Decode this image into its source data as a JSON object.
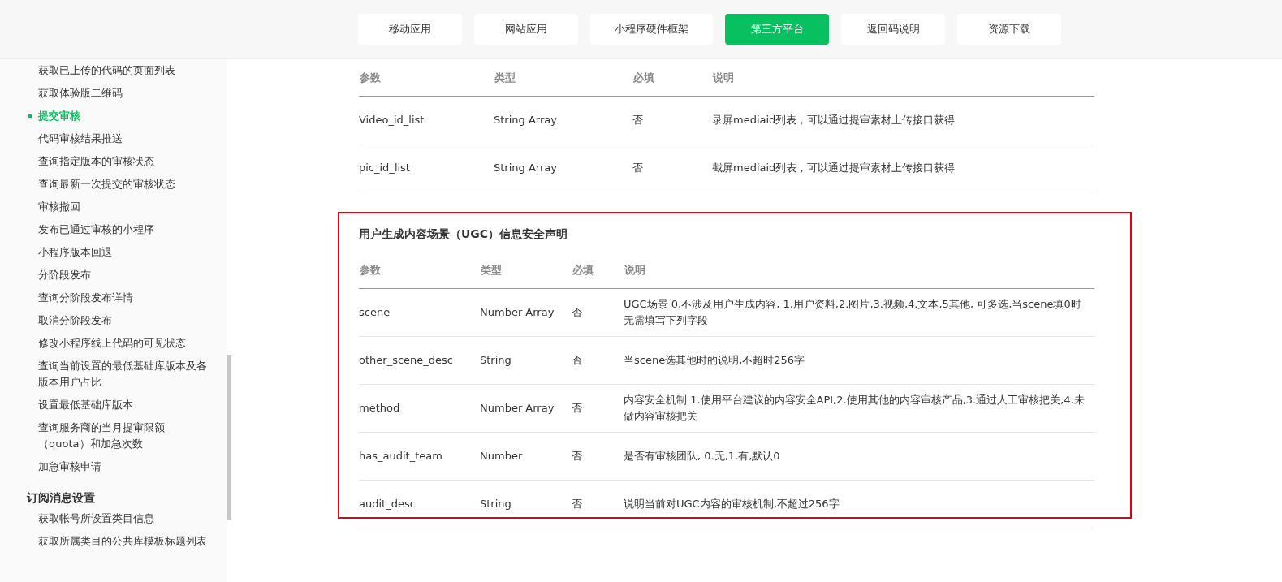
{
  "nav_tabs": [
    {
      "label": "移动应用",
      "selected": false
    },
    {
      "label": "网站应用",
      "selected": false
    },
    {
      "label": "小程序硬件框架",
      "selected": false
    },
    {
      "label": "第三方平台",
      "selected": true
    },
    {
      "label": "返回码说明",
      "selected": false
    },
    {
      "label": "资源下载",
      "selected": false
    }
  ],
  "sidebar": {
    "groups": [
      {
        "items": [
          {
            "label": "获取已上传的代码的页面列表",
            "selected": false
          },
          {
            "label": "获取体验版二维码",
            "selected": false
          },
          {
            "label": "提交审核",
            "selected": true
          },
          {
            "label": "代码审核结果推送",
            "selected": false
          },
          {
            "label": "查询指定版本的审核状态",
            "selected": false
          },
          {
            "label": "查询最新一次提交的审核状态",
            "selected": false
          },
          {
            "label": "审核撤回",
            "selected": false
          },
          {
            "label": "发布已通过审核的小程序",
            "selected": false
          },
          {
            "label": "小程序版本回退",
            "selected": false
          },
          {
            "label": "分阶段发布",
            "selected": false
          },
          {
            "label": "查询分阶段发布详情",
            "selected": false
          },
          {
            "label": "取消分阶段发布",
            "selected": false
          },
          {
            "label": "修改小程序线上代码的可见状态",
            "selected": false
          },
          {
            "label": "查询当前设置的最低基础库版本及各版本用户占比",
            "selected": false
          },
          {
            "label": "设置最低基础库版本",
            "selected": false
          },
          {
            "label": "查询服务商的当月提审限额（quota）和加急次数",
            "selected": false
          },
          {
            "label": "加急审核申请",
            "selected": false
          }
        ]
      },
      {
        "title": "订阅消息设置",
        "items": [
          {
            "label": "获取帐号所设置类目信息",
            "selected": false
          },
          {
            "label": "获取所属类目的公共库模板标题列表",
            "selected": false
          }
        ]
      }
    ]
  },
  "params_table": {
    "columns": [
      "参数",
      "类型",
      "必填",
      "说明"
    ],
    "rows": [
      [
        "Video_id_list",
        "String Array",
        "否",
        "录屏mediaid列表，可以通过提审素材上传接口获得"
      ],
      [
        "pic_id_list",
        "String Array",
        "否",
        "截屏mediaid列表，可以通过提审素材上传接口获得"
      ]
    ]
  },
  "ugc_section": {
    "title": "用户生成内容场景（UGC）信息安全声明",
    "highlighted": true,
    "columns": [
      "参数",
      "类型",
      "必填",
      "说明"
    ],
    "rows": [
      [
        "scene",
        "Number Array",
        "否",
        "UGC场景 0,不涉及用户生成内容, 1.用户资料,2.图片,3.视频,4.文本,5其他, 可多选,当scene填0时无需填写下列字段"
      ],
      [
        "other_scene_desc",
        "String",
        "否",
        "当scene选其他时的说明,不超时256字"
      ],
      [
        "method",
        "Number Array",
        "否",
        "内容安全机制 1.使用平台建议的内容安全API,2.使用其他的内容审核产品,3.通过人工审核把关,4.未做内容审核把关"
      ],
      [
        "has_audit_team",
        "Number",
        "否",
        "是否有审核团队, 0.无,1.有,默认0"
      ],
      [
        "audit_desc",
        "String",
        "否",
        "说明当前对UGC内容的审核机制,不超过256字"
      ]
    ]
  }
}
